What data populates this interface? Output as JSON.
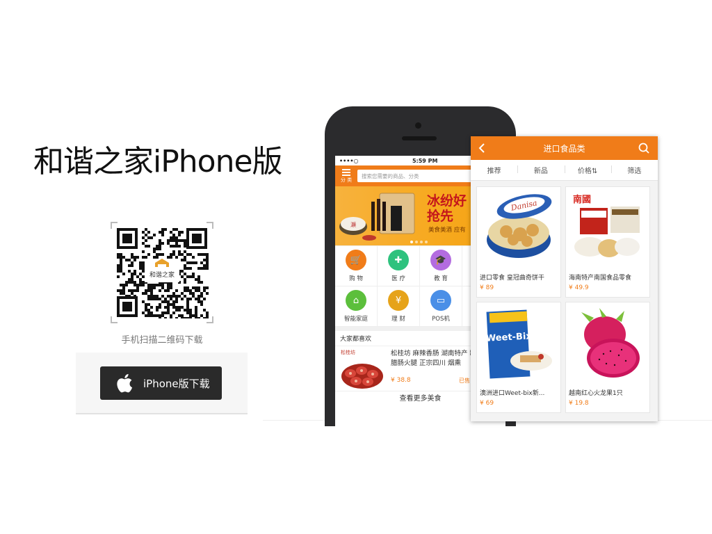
{
  "promo": {
    "headline": "和谐之家iPhone版",
    "qr_caption": "手机扫描二维码下载",
    "qr_logo_text": "和谐之家",
    "download_label": "iPhone版下载"
  },
  "phone": {
    "status": {
      "signal": "••••○",
      "time": "5:59 PM"
    },
    "category_label": "分 类",
    "search_placeholder": "搜索您需要的商品、分类",
    "banner": {
      "line1": "冰纷好",
      "line2": "抢先",
      "line3": "美食美酒 应有"
    },
    "grid": [
      {
        "label": "购 物",
        "color": "#f07c19",
        "icon": "cart-icon",
        "glyph": "🛒"
      },
      {
        "label": "医 疗",
        "color": "#2ec27e",
        "icon": "medical-icon",
        "glyph": "✚"
      },
      {
        "label": "教 育",
        "color": "#b36ce0",
        "icon": "education-icon",
        "glyph": "🎓"
      },
      {
        "label": "",
        "color": "#4a90e2",
        "icon": "more-icon",
        "glyph": ""
      },
      {
        "label": "智能家庭",
        "color": "#5cbf3c",
        "icon": "smart-home-icon",
        "glyph": "⌂"
      },
      {
        "label": "理 财",
        "color": "#e6a31a",
        "icon": "finance-icon",
        "glyph": "¥"
      },
      {
        "label": "POS机",
        "color": "#4a8fe7",
        "icon": "pos-icon",
        "glyph": "▭"
      },
      {
        "label": "",
        "color": "#d65db1",
        "icon": "more-icon",
        "glyph": ""
      }
    ],
    "favorites_title": "大家都喜欢",
    "favorite": {
      "brand": "松桂坊",
      "desc": "松桂坊 麻辣香肠 湖南特产 制腊肠火腿 正宗四川 烟熏",
      "price": "¥ 38.8",
      "sold": "已售"
    },
    "see_more": "查看更多美食"
  },
  "card": {
    "title": "进口食品类",
    "sort_options": [
      "推荐",
      "新品",
      "价格⇅",
      "筛选"
    ],
    "products": [
      {
        "name": "进口零食 皇冠曲奇饼干",
        "price": "¥ 89"
      },
      {
        "name": "海南特产南国食品零食",
        "price": "¥ 49.9"
      },
      {
        "name": "澳洲进口Weet-bix新...",
        "price": "¥ 69"
      },
      {
        "name": "越南红心火龙果1只",
        "price": "¥ 19.8"
      }
    ]
  }
}
